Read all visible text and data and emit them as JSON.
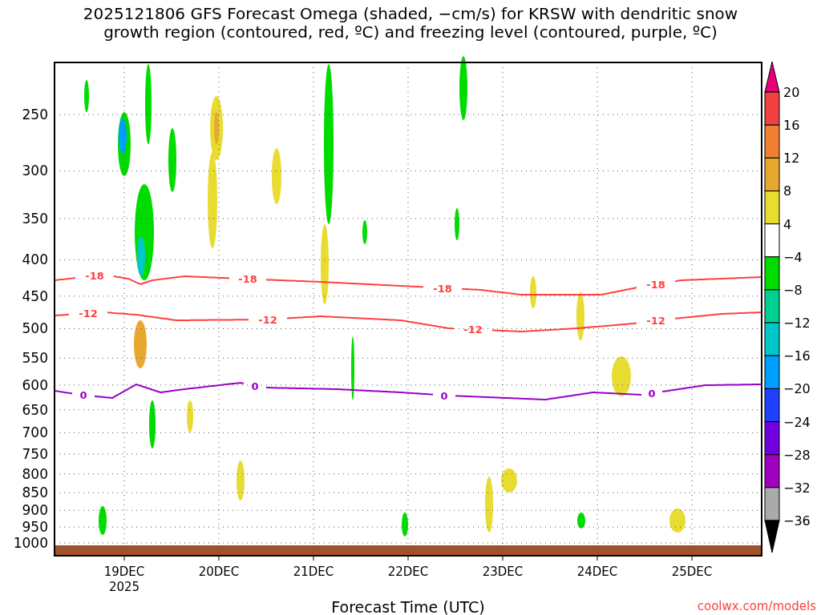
{
  "title": [
    "2025121806 GFS Forecast Omega (shaded, −cm/s) for KRSW with dendritic snow",
    "growth region (contoured, red, ºC) and freezing level (contoured, purple, ºC)"
  ],
  "y_axis": {
    "ticks": [
      "250",
      "300",
      "350",
      "400",
      "450",
      "500",
      "550",
      "600",
      "650",
      "700",
      "750",
      "800",
      "850",
      "900",
      "950",
      "1000"
    ]
  },
  "x_axis": {
    "ticks": [
      {
        "label": "19DEC",
        "sublabel": "2025"
      },
      {
        "label": "20DEC"
      },
      {
        "label": "21DEC"
      },
      {
        "label": "22DEC"
      },
      {
        "label": "23DEC"
      },
      {
        "label": "24DEC"
      },
      {
        "label": "25DEC"
      }
    ],
    "title": "Forecast Time (UTC)"
  },
  "contours": [
    {
      "kind": "dgz_top",
      "color": "#ff4040",
      "labels": [
        "-18",
        "-18",
        "-18",
        "-18"
      ]
    },
    {
      "kind": "dgz_bottom",
      "color": "#ff4040",
      "labels": [
        "-12",
        "-12",
        "-12",
        "-12"
      ]
    },
    {
      "kind": "freezing",
      "color": "#9a00c8",
      "labels": [
        "0",
        "0",
        "0",
        "0"
      ]
    }
  ],
  "colorbar": {
    "labels": [
      "20",
      "16",
      "12",
      "8",
      "4",
      "−4",
      "−8",
      "−12",
      "−16",
      "−20",
      "−24",
      "−28",
      "−32",
      "−36"
    ],
    "bins": [
      {
        "kind": "over",
        "color": "#e8007a"
      },
      {
        "kind": "bin",
        "color": "#f04040"
      },
      {
        "kind": "bin",
        "color": "#f08030"
      },
      {
        "kind": "bin",
        "color": "#e8a830"
      },
      {
        "kind": "bin",
        "color": "#e8dc30"
      },
      {
        "kind": "bin",
        "color": "#ffffff"
      },
      {
        "kind": "bin",
        "color": "#00dc00"
      },
      {
        "kind": "bin",
        "color": "#00d090"
      },
      {
        "kind": "bin",
        "color": "#00c8c8"
      },
      {
        "kind": "bin",
        "color": "#00a0ff"
      },
      {
        "kind": "bin",
        "color": "#2040ff"
      },
      {
        "kind": "bin",
        "color": "#7000e0"
      },
      {
        "kind": "bin",
        "color": "#a000c0"
      },
      {
        "kind": "bin",
        "color": "#aaaaaa"
      },
      {
        "kind": "under",
        "color": "#000000"
      }
    ]
  },
  "credit": "coolwx.com/models"
}
